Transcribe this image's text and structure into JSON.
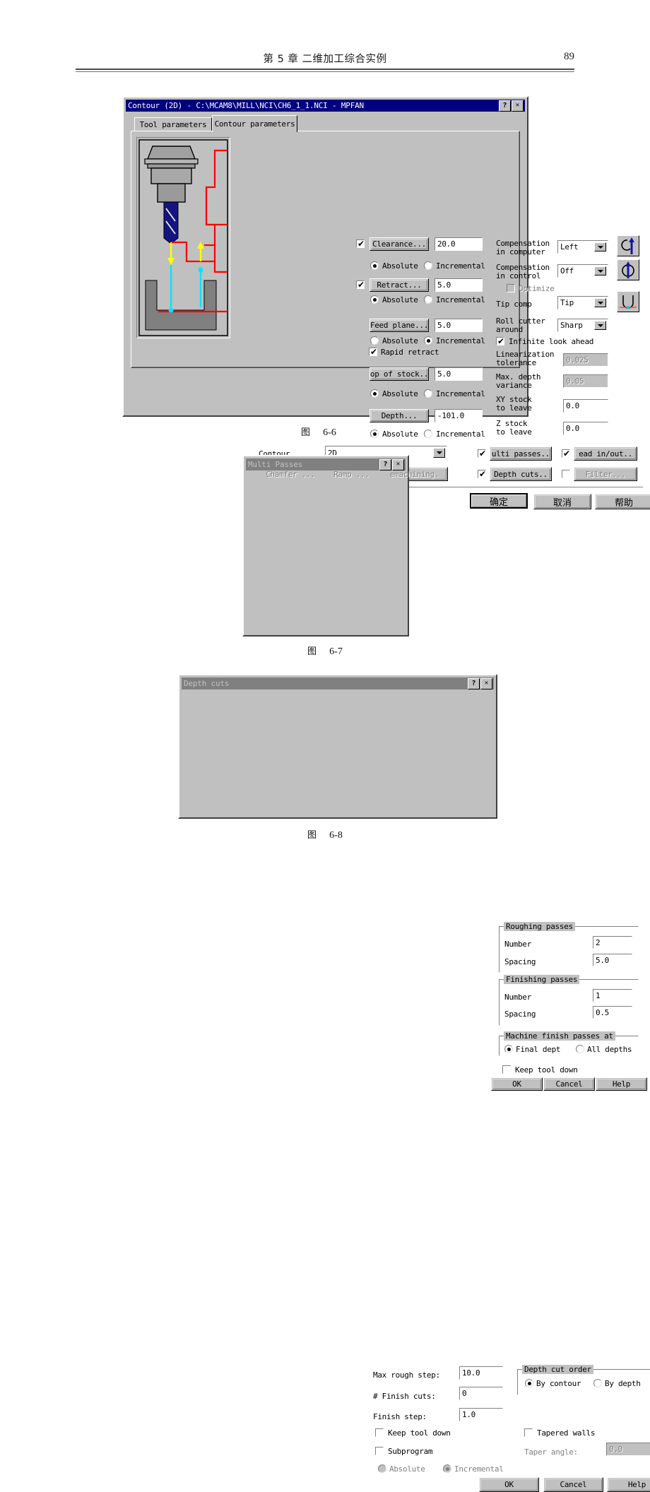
{
  "page": {
    "chapter_title": "第 5 章   二维加工综合实例",
    "page_number": "89"
  },
  "captions": {
    "fig1": "图",
    "fig1_num": "6-6",
    "fig2": "图",
    "fig2_num": "6-7",
    "fig3": "图",
    "fig3_num": "6-8"
  },
  "contour_dialog": {
    "title": "Contour (2D) - C:\\MCAM8\\MILL\\NCI\\CH6_1_1.NCI - MPFAN",
    "help_btn": "?",
    "close_btn": "✕",
    "tabs": [
      {
        "label": "Tool parameters",
        "active": false
      },
      {
        "label": "Contour parameters",
        "active": true
      }
    ],
    "left_params": [
      {
        "check": "✔",
        "button": "Clearance...",
        "value": "20.0",
        "mode": "absolute",
        "radio_abs": "Absolute",
        "radio_inc": "Incremental"
      },
      {
        "check": "✔",
        "button": "Retract...",
        "value": "5.0",
        "mode": "absolute",
        "radio_abs": "Absolute",
        "radio_inc": "Incremental"
      },
      {
        "check": "",
        "button": "Feed plane...",
        "value": "5.0",
        "mode": "incremental",
        "radio_abs": "Absolute",
        "radio_inc": "Incremental"
      },
      {
        "check": "",
        "button": "op of stock..",
        "value": "5.0",
        "mode": "absolute",
        "radio_abs": "Absolute",
        "radio_inc": "Incremental"
      },
      {
        "check": "",
        "button": "Depth...",
        "value": "-101.0",
        "mode": "absolute",
        "radio_abs": "Absolute",
        "radio_inc": "Incremental"
      }
    ],
    "rapid_retract": {
      "label": "Rapid retract",
      "checked": "✔"
    },
    "right_params": {
      "comp_computer_label_1": "Compensation",
      "comp_computer_label_2": "in computer",
      "comp_computer_value": "Left",
      "comp_control_label_1": "Compensation",
      "comp_control_label_2": "in control",
      "comp_control_value": "Off",
      "optimize_label": "Optimize",
      "tip_comp_label": "Tip comp",
      "tip_comp_value": "Tip",
      "roll_cutter_label_1": "Roll cutter",
      "roll_cutter_label_2": "around",
      "roll_cutter_value": "Sharp",
      "infinite_look_ahead": "Infinite look ahead",
      "infinite_check": "✔",
      "linearization_label_1": "Linearization",
      "linearization_label_2": "tolerance",
      "linearization_value": "0.025",
      "maxdepth_label_1": "Max. depth",
      "maxdepth_label_2": "variance",
      "maxdepth_value": "0.05",
      "xystock_label_1": "XY stock",
      "xystock_label_2": "to leave",
      "xystock_value": "0.0",
      "zstock_label_1": "Z stock",
      "zstock_label_2": "to leave",
      "zstock_value": "0.0"
    },
    "bottom": {
      "contour_label": "Contour",
      "contour_type": "2D",
      "chamfer": "Chamfer ...",
      "ramp": "Ramp ...",
      "remachining": "emachining.",
      "multi_passes": "ulti passes..",
      "multi_passes_check": "✔",
      "lead_inout": "ead in/out..",
      "lead_inout_check": "✔",
      "depth_cuts": "Depth cuts..",
      "depth_cuts_check": "✔",
      "filter": "Filter...",
      "filter_check": ""
    },
    "footer": {
      "ok": "确定",
      "cancel": "取消",
      "help": "帮助"
    }
  },
  "multi_passes_dialog": {
    "title": "Multi Passes",
    "help_btn": "?",
    "close_btn": "✕",
    "roughing_group": "Roughing passes",
    "roughing_number_label": "Number",
    "roughing_number_value": "2",
    "roughing_spacing_label": "Spacing",
    "roughing_spacing_value": "5.0",
    "finishing_group": "Finishing passes",
    "finishing_number_label": "Number",
    "finishing_number_value": "1",
    "finishing_spacing_label": "Spacing",
    "finishing_spacing_value": "0.5",
    "machine_group": "Machine finish passes at",
    "final_depth": "Final dept",
    "all_depths": "All depths",
    "keep_tool_down": "Keep tool down",
    "ok": "OK",
    "cancel": "Cancel",
    "help": "Help"
  },
  "depth_cuts_dialog": {
    "title": "Depth cuts",
    "help_btn": "?",
    "close_btn": "✕",
    "max_rough_step_label": "Max rough step:",
    "max_rough_step_value": "10.0",
    "finish_cuts_label": "# Finish cuts:",
    "finish_cuts_value": "0",
    "finish_step_label": "Finish step:",
    "finish_step_value": "1.0",
    "order_group": "Depth cut order",
    "by_contour": "By contour",
    "by_depth": "By depth",
    "keep_tool_down": "Keep tool down",
    "subprogram": "Subprogram",
    "absolute": "Absolute",
    "incremental": "Incremental",
    "tapered_walls": "Tapered walls",
    "taper_angle_label": "Taper angle:",
    "taper_angle_value": "0.0",
    "ok": "OK",
    "cancel": "Cancel",
    "help": "Help"
  },
  "colors": {
    "titlebar_active": "#000080",
    "titlebar_inactive": "#808080",
    "face": "#c0c0c0",
    "toolpath_rapid": "#ff0000",
    "toolpath_feed": "#ffff00",
    "toolpath_plunge": "#00ffff",
    "tool_flute": "#000080"
  }
}
